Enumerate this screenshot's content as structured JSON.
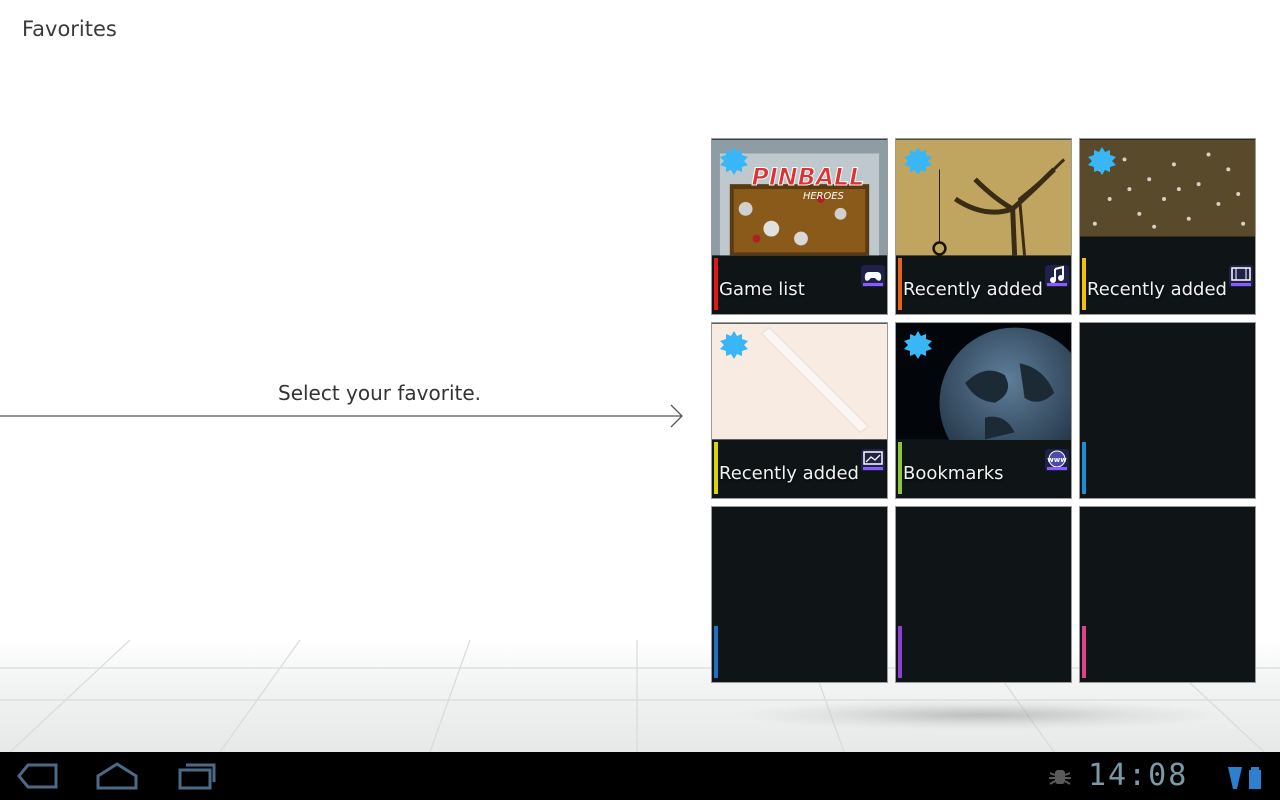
{
  "header": {
    "title": "Favorites"
  },
  "prompt": {
    "text": "Select your favorite."
  },
  "tiles": [
    {
      "label": "Game list",
      "accent": "#e01818",
      "type_icon": "gamepad-icon",
      "is_new": true
    },
    {
      "label": "Recently added",
      "accent": "#e8631a",
      "type_icon": "music-note-icon",
      "is_new": true
    },
    {
      "label": "Recently added",
      "accent": "#f0c20c",
      "type_icon": "film-strip-icon",
      "is_new": true
    },
    {
      "label": "Recently added",
      "accent": "#d8d40c",
      "type_icon": "photo-icon",
      "is_new": true
    },
    {
      "label": "Bookmarks",
      "accent": "#8cc63e",
      "type_icon": "www-globe-icon",
      "is_new": true
    },
    {
      "label": "",
      "accent": "#1b8fd6"
    },
    {
      "label": "",
      "accent": "#1f6fc4"
    },
    {
      "label": "",
      "accent": "#8f3fd4"
    },
    {
      "label": "",
      "accent": "#e0428a"
    }
  ],
  "system_bar": {
    "clock": "14:08",
    "nav": [
      "back-icon",
      "home-icon",
      "recent-apps-icon"
    ],
    "status": [
      "debug-icon",
      "wifi-icon",
      "battery-icon"
    ]
  },
  "colors": {
    "new_badge": "#39b6f5",
    "tile_bg": "#0f1517",
    "clock": "#7a9aa8"
  }
}
